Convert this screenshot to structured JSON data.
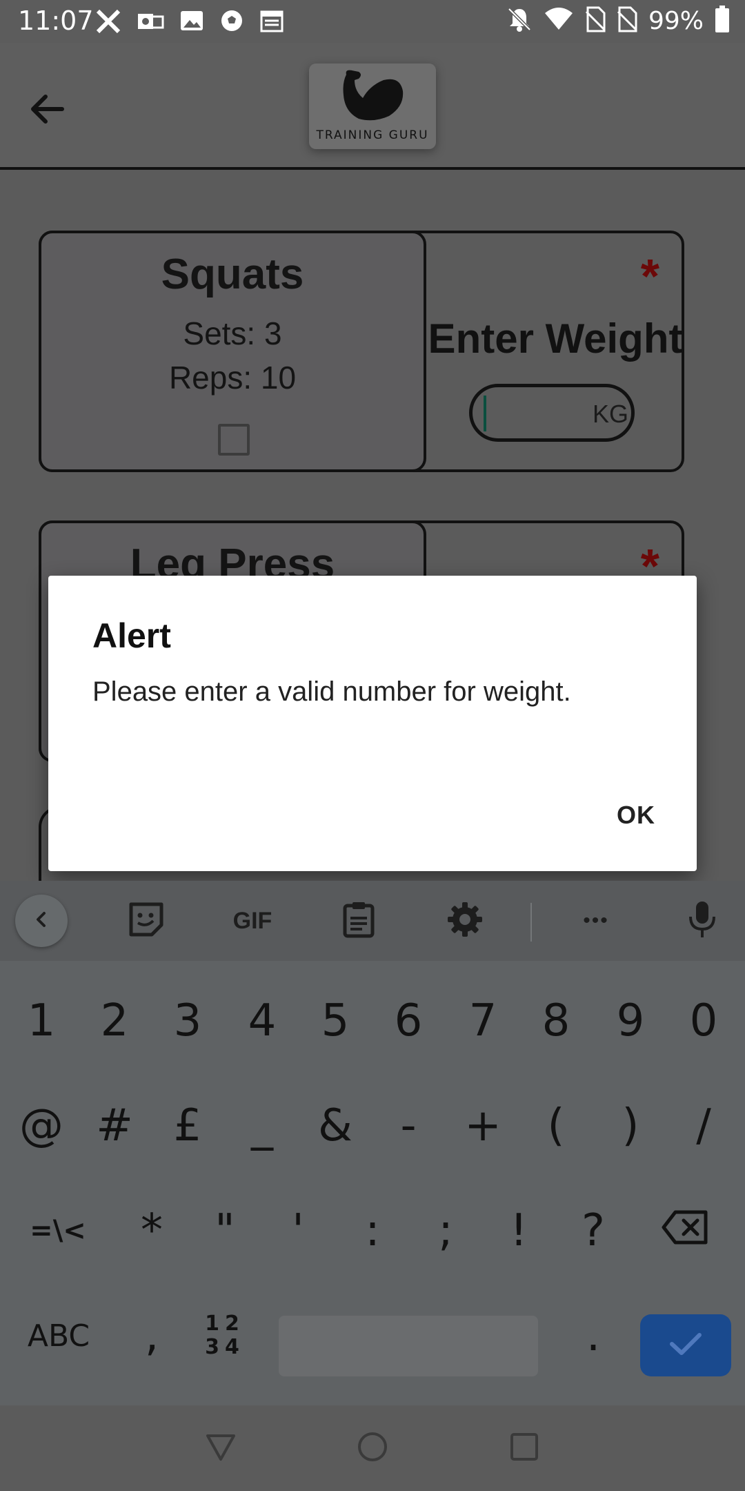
{
  "status_bar": {
    "time": "11:07",
    "battery": "99%",
    "left_icons": [
      "x-icon",
      "outlook-icon",
      "image-icon",
      "soccer-ball-icon",
      "calendar-icon"
    ],
    "right_icons": [
      "notifications-off-icon",
      "wifi-icon",
      "no-sim-icon",
      "no-sim-icon",
      "battery-icon"
    ]
  },
  "app_bar": {
    "logo_text": "TRAINING GURU"
  },
  "exercises": [
    {
      "name": "Squats",
      "sets": "Sets: 3",
      "reps": "Reps: 10",
      "weight_label": "Enter Weight",
      "unit": "KG",
      "required": "*"
    },
    {
      "name": "Leg Press",
      "required": "*"
    }
  ],
  "dialog": {
    "title": "Alert",
    "message": "Please enter a valid number for weight.",
    "ok_label": "OK"
  },
  "keyboard": {
    "toolbar_icons": [
      "chevron-left-icon",
      "sticker-icon",
      "gif-icon",
      "clipboard-icon",
      "settings-icon",
      "more-icon",
      "microphone-icon"
    ],
    "gif_label": "GIF",
    "more_label": "•••",
    "row1": [
      "1",
      "2",
      "3",
      "4",
      "5",
      "6",
      "7",
      "8",
      "9",
      "0"
    ],
    "row2": [
      "@",
      "#",
      "£",
      "_",
      "&",
      "-",
      "+",
      "(",
      ")",
      "/"
    ],
    "row3": [
      "=\\<",
      "*",
      "\"",
      "'",
      ":",
      ";",
      "!",
      "?"
    ],
    "row4": {
      "abc": "ABC",
      "comma": ",",
      "num_top": "12",
      "num_bottom": "34",
      "period": "."
    },
    "accent_color": "#1a4a8e"
  },
  "navigation": {
    "icons": [
      "back-triangle-icon",
      "home-circle-icon",
      "recents-square-icon"
    ]
  }
}
